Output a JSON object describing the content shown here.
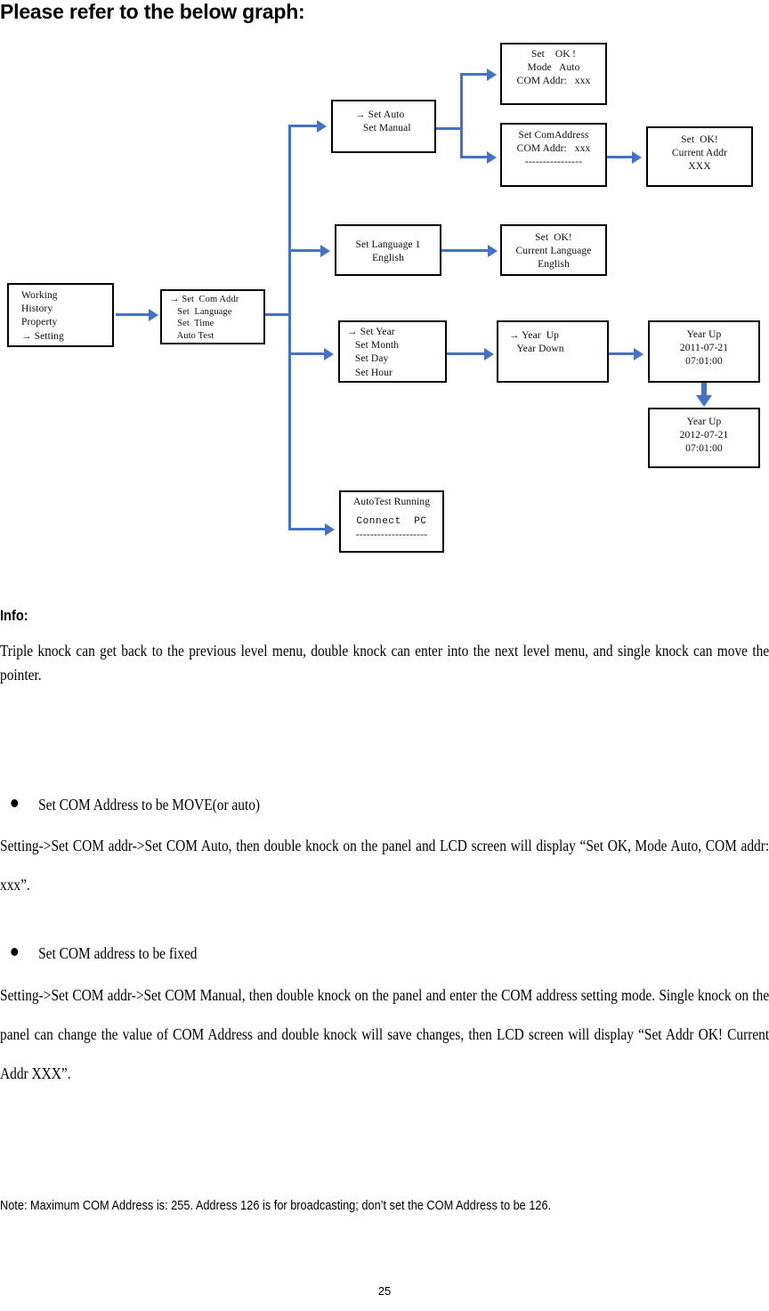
{
  "heading": "Please refer to the below graph:",
  "diagram": {
    "nodes": {
      "main_menu": {
        "name": "main-menu-screen",
        "lines": [
          "Working",
          "History",
          "Property",
          "→ Setting"
        ]
      },
      "setting_menu": {
        "name": "setting-menu-screen",
        "lines": [
          "→ Set  Com Addr",
          "   Set  Language",
          "   Set  Time",
          "   Auto Test"
        ]
      },
      "com_mode_menu": {
        "name": "com-mode-menu-screen",
        "lines": [
          "→ Set Auto",
          "   Set Manual"
        ]
      },
      "set_ok_auto": {
        "name": "set-ok-auto-screen",
        "lines": [
          "Set    OK !",
          "Mode   Auto",
          "COM Addr:   xxx"
        ]
      },
      "set_comaddress": {
        "name": "set-comaddress-screen",
        "lines": [
          "Set ComAddress",
          "COM Addr:   xxx",
          "----------------"
        ]
      },
      "set_ok_addr": {
        "name": "set-ok-current-addr-screen",
        "lines": [
          "Set  OK!",
          "Current Addr",
          "XXX"
        ]
      },
      "set_language": {
        "name": "set-language-screen",
        "lines": [
          "Set Language 1",
          "English"
        ]
      },
      "set_ok_language": {
        "name": "set-ok-language-screen",
        "lines": [
          "Set  OK!",
          "Current Language",
          "English"
        ]
      },
      "set_time_menu": {
        "name": "set-time-menu-screen",
        "lines": [
          "→ Set Year",
          "   Set Month",
          "   Set Day",
          "   Set Hour"
        ]
      },
      "year_updown": {
        "name": "year-up-down-screen",
        "lines": [
          "→ Year  Up",
          "   Year Down"
        ]
      },
      "year_2011": {
        "name": "year-up-2011-screen",
        "lines": [
          "Year Up",
          "2011-07-21",
          "07:01:00"
        ]
      },
      "year_2012": {
        "name": "year-up-2012-screen",
        "lines": [
          "Year Up",
          "2012-07-21",
          "07:01:00"
        ]
      },
      "autotest": {
        "name": "autotest-running-screen",
        "title": "AutoTest Running",
        "mono": "Connect  PC",
        "dashes": "--------------------"
      }
    },
    "connector_color": "#4472C4"
  },
  "info": {
    "label": "Info:",
    "paragraph": "Triple knock can get back to the previous level menu, double knock can enter into the next level menu, and single knock can move the pointer."
  },
  "sections": [
    {
      "bullet": "Set COM Address to be MOVE(or auto)",
      "body": "Setting->Set COM addr->Set COM Auto, then double knock on the panel and LCD screen will display “Set OK, Mode Auto, COM addr: xxx”."
    },
    {
      "bullet": "Set COM address to be fixed",
      "body": "Setting->Set COM addr->Set COM Manual, then double knock on the panel and enter the COM address setting mode. Single knock on the panel can change the value of COM Address and double knock will save changes, then LCD screen will display “Set Addr OK! Current Addr XXX”."
    }
  ],
  "note": "Note: Maximum COM Address is: 255. Address 126 is for broadcasting; don’t set the COM Address to be 126.",
  "page_number": "25"
}
